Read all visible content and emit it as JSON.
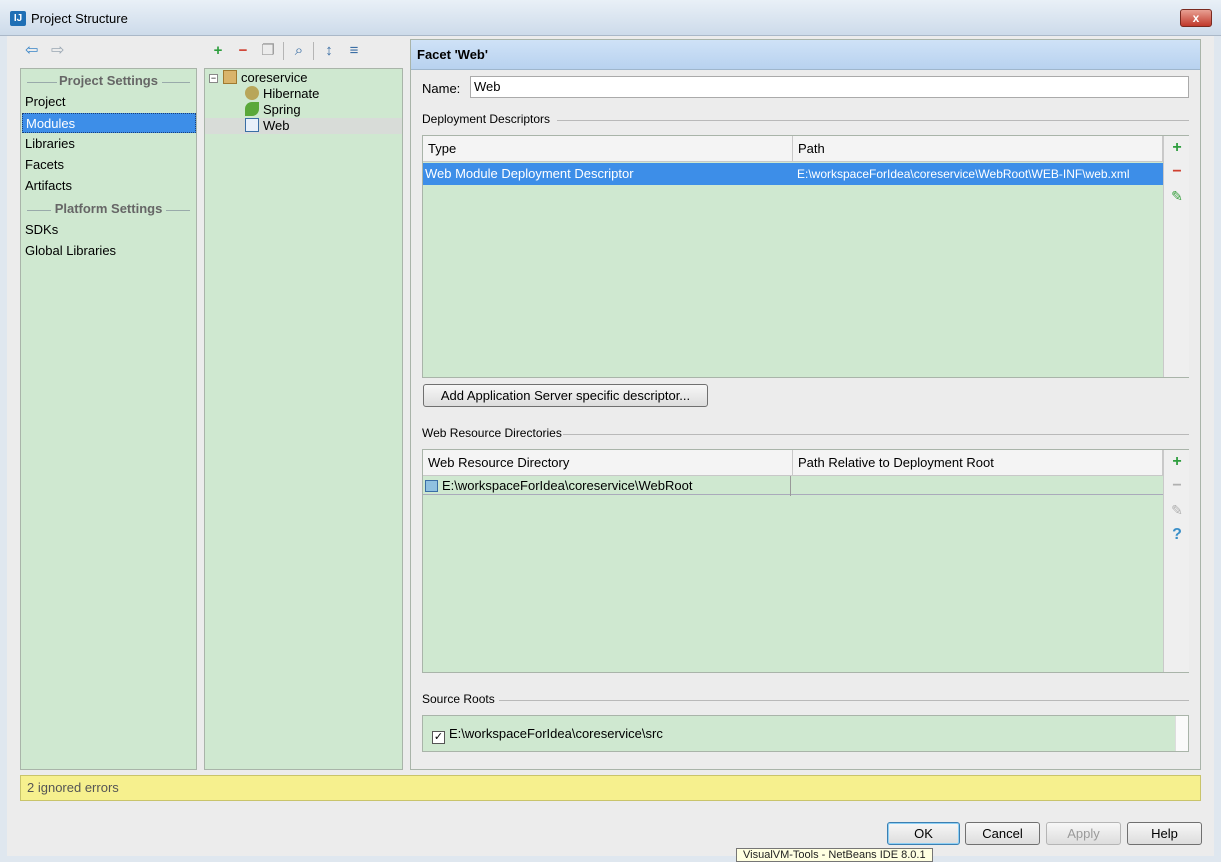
{
  "window": {
    "title": "Project Structure",
    "close_label": "x",
    "app_icon_text": "IJ"
  },
  "sidebar": {
    "project_settings_header": "Project Settings",
    "platform_settings_header": "Platform Settings",
    "items": [
      {
        "label": "Project"
      },
      {
        "label": "Modules"
      },
      {
        "label": "Libraries"
      },
      {
        "label": "Facets"
      },
      {
        "label": "Artifacts"
      },
      {
        "label": "SDKs"
      },
      {
        "label": "Global Libraries"
      }
    ]
  },
  "tree": {
    "root": "coreservice",
    "children": [
      {
        "label": "Hibernate"
      },
      {
        "label": "Spring"
      },
      {
        "label": "Web"
      }
    ]
  },
  "facet": {
    "header": "Facet 'Web'",
    "name_label": "Name:",
    "name_value": "Web",
    "deployment_title": "Deployment Descriptors",
    "deployment_columns": [
      "Type",
      "Path"
    ],
    "deployment_row": {
      "type": "Web Module Deployment Descriptor",
      "path": "E:\\workspaceForIdea\\coreservice\\WebRoot\\WEB-INF\\web.xml"
    },
    "add_server_descriptor_label": "Add Application Server specific descriptor...",
    "web_resource_title": "Web Resource Directories",
    "web_resource_columns": [
      "Web Resource Directory",
      "Path Relative to Deployment Root"
    ],
    "web_resource_row": {
      "directory": "E:\\workspaceForIdea\\coreservice\\WebRoot",
      "relative": ""
    },
    "source_roots_title": "Source Roots",
    "source_root": "E:\\workspaceForIdea\\coreservice\\src"
  },
  "status": {
    "text": "2 ignored errors"
  },
  "buttons": {
    "ok": "OK",
    "cancel": "Cancel",
    "apply": "Apply",
    "help": "Help"
  },
  "taskbar_tooltip": "VisualVM-Tools - NetBeans IDE 8.0.1",
  "colors": {
    "selection": "#3d8ee8",
    "panel_bg": "#cfe8d0",
    "status_bg": "#f6f08e"
  }
}
